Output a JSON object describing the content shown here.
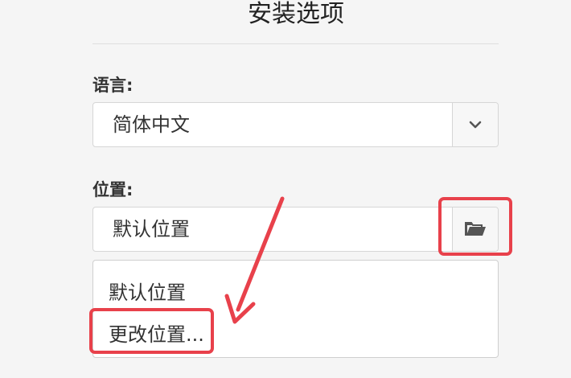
{
  "page": {
    "title": "安装选项"
  },
  "language": {
    "label": "语言:",
    "selected": "简体中文",
    "dropdown_icon": "chevron-down-icon"
  },
  "location": {
    "label": "位置:",
    "selected": "默认位置",
    "browse_icon": "folder-open-icon",
    "options": [
      "默认位置",
      "更改位置..."
    ]
  },
  "annotation": {
    "color": "#e8414b"
  }
}
